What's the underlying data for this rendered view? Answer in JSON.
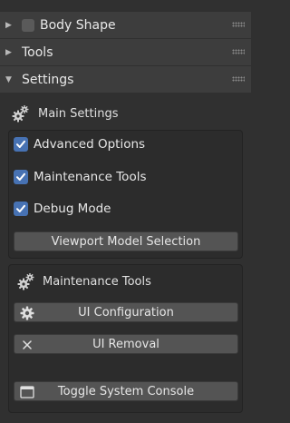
{
  "panels": {
    "body_shape": {
      "label": "Body Shape",
      "collapsed": true
    },
    "tools": {
      "label": "Tools",
      "collapsed": true
    },
    "settings": {
      "label": "Settings",
      "collapsed": false
    }
  },
  "main_settings": {
    "title": "Main Settings",
    "options": [
      {
        "label": "Advanced Options",
        "checked": true
      },
      {
        "label": "Maintenance Tools",
        "checked": true
      },
      {
        "label": "Debug Mode",
        "checked": true
      }
    ],
    "viewport_button": "Viewport Model Selection"
  },
  "maintenance_tools": {
    "title": "Maintenance Tools",
    "ui_configuration": "UI Configuration",
    "ui_removal": "UI Removal",
    "toggle_console": "Toggle System Console"
  },
  "colors": {
    "checkbox_accent": "#4772b3",
    "button": "#545454",
    "header": "#3d3d3d",
    "background": "#303030"
  }
}
